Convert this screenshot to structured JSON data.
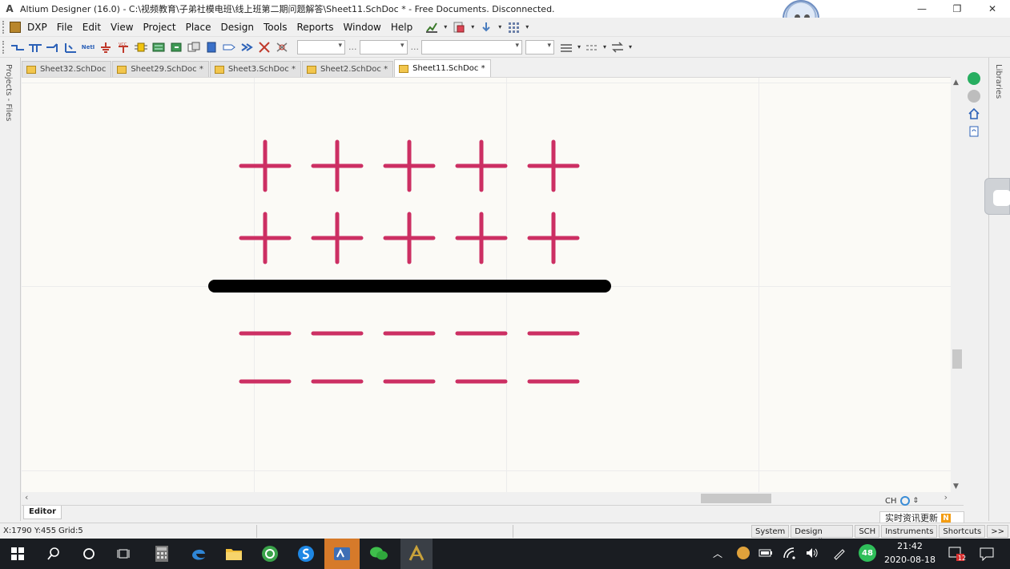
{
  "window": {
    "title": "Altium Designer (16.0) - C:\\视频教育\\子弟社模电班\\线上班第二期问题解答\\Sheet11.SchDoc * - Free Documents. Disconnected.",
    "controls": [
      "—",
      "❐",
      "✕"
    ]
  },
  "menu": {
    "items": [
      "DXP",
      "File",
      "Edit",
      "View",
      "Project",
      "Place",
      "Design",
      "Tools",
      "Reports",
      "Window",
      "Help"
    ]
  },
  "left_panel": {
    "label": "Projects - Files"
  },
  "right_panel": {
    "label": "Libraries"
  },
  "tabs": [
    {
      "label": "Sheet32.SchDoc",
      "active": false
    },
    {
      "label": "Sheet29.SchDoc *",
      "active": false
    },
    {
      "label": "Sheet3.SchDoc *",
      "active": false
    },
    {
      "label": "Sheet2.SchDoc *",
      "active": false
    },
    {
      "label": "Sheet11.SchDoc *",
      "active": true
    }
  ],
  "canvas": {
    "plus_rows": 2,
    "minus_rows": 2,
    "columns": 5,
    "symbol_color": "#cc2f63",
    "separator_color": "#000000"
  },
  "editor_tab": {
    "label": "Editor"
  },
  "status": {
    "coords": "X:1790 Y:455",
    "grid": "Grid:5",
    "panels": [
      "System",
      "Design Compiler",
      "SCH",
      "Instruments",
      "Shortcuts"
    ],
    "more": ">>"
  },
  "ime": {
    "lang": "CH"
  },
  "news": {
    "label": "实时资讯更新",
    "badge": "N"
  },
  "taskbar": {
    "time": "21:42",
    "date": "2020-08-18",
    "battery_badge": "48",
    "notif_badge": "12"
  }
}
